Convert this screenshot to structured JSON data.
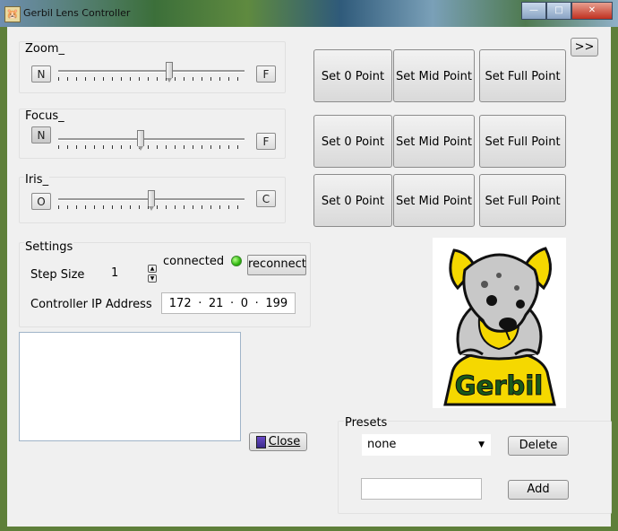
{
  "window": {
    "title": "Gerbil  Lens Controller"
  },
  "zoom": {
    "label": "Zoom_",
    "min_label": "N",
    "max_label": "F",
    "position": 0.6
  },
  "focus": {
    "label": "Focus_",
    "min_label": "N",
    "max_label": "F",
    "position": 0.44
  },
  "iris": {
    "label": "Iris_",
    "min_label": "O",
    "max_label": "C",
    "position": 0.5
  },
  "point_buttons": {
    "set0": "Set 0 Point",
    "setmid": "Set Mid Point",
    "setfull": "Set Full Point"
  },
  "expand_button": ">>",
  "settings": {
    "label": "Settings",
    "step_size_label": "Step Size",
    "step_size_value": "1",
    "status": "connected",
    "reconnect_label": "reconnect",
    "ip_label": "Controller IP Address",
    "ip": {
      "o1": "172",
      "o2": "21",
      "o3": "0",
      "o4": "199"
    }
  },
  "close_label": "Close",
  "presets": {
    "label": "Presets",
    "selected": "none",
    "delete_label": "Delete",
    "add_label": "Add",
    "name_value": ""
  },
  "logo_text": "Gerbil",
  "colors": {
    "led_on": "#2fb80f",
    "logo_yellow": "#f5d800"
  }
}
